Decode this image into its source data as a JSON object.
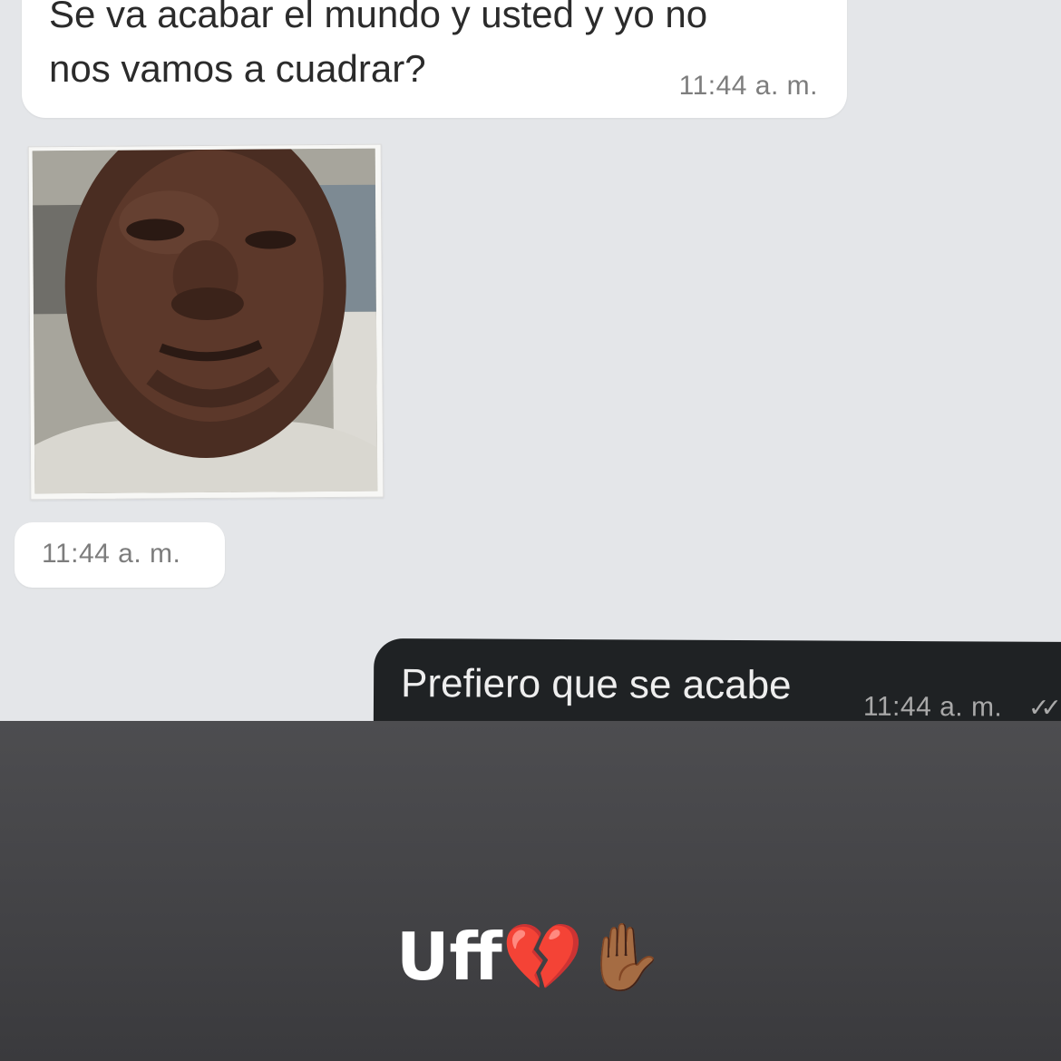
{
  "chat": {
    "incoming_message": {
      "text": "Se va acabar el mundo y usted y yo no\nnos vamos a cuadrar?",
      "time": "11:44 a. m."
    },
    "incoming_photo": {
      "time": "11:44 a. m."
    },
    "outgoing_message": {
      "text": "Prefiero que se acabe",
      "time": "11:44 a. m.",
      "status_icon": "double-check-icon"
    }
  },
  "story": {
    "caption": "Uff💔✋🏾"
  },
  "colors": {
    "chat_background": "#e4e6e9",
    "incoming_bubble": "#ffffff",
    "outgoing_bubble": "#1f2224",
    "story_background": "#454548",
    "caption_text": "#ffffff"
  }
}
